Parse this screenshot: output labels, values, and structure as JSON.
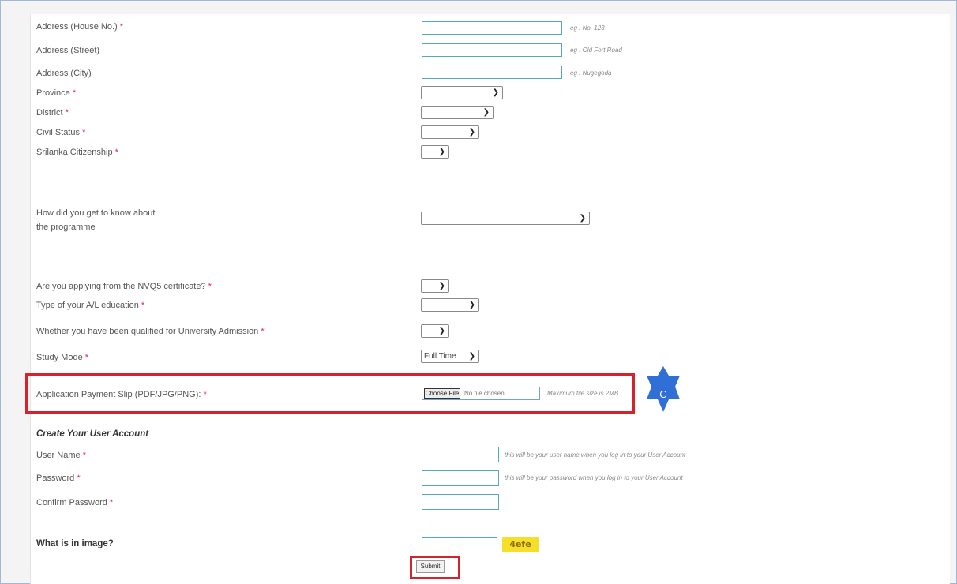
{
  "fields": {
    "house_no": {
      "label": "Address (House No.)",
      "hint": "eg : No. 123"
    },
    "street": {
      "label": "Address (Street)",
      "hint": "eg : Old Fort Road"
    },
    "city": {
      "label": "Address (City)",
      "hint": "eg : Nugegoda"
    },
    "province": {
      "label": "Province"
    },
    "district": {
      "label": "District"
    },
    "civil_status": {
      "label": "Civil Status"
    },
    "citizenship": {
      "label": "Srilanka Citizenship"
    },
    "how_know_line1": "How did you get to know about",
    "how_know_line2": "the programme",
    "nvq": {
      "label": "Are you applying from the NVQ5 certificate?"
    },
    "al_type": {
      "label": "Type of your A/L education"
    },
    "university": {
      "label": "Whether you have been qualified for University Admission"
    },
    "study_mode": {
      "label": "Study Mode",
      "value": "Full Time"
    },
    "payment_slip": {
      "label": "Application Payment Slip (PDF/JPG/PNG):",
      "choose_button": "Choose File",
      "no_file": "No file chosen",
      "hint": "Maximum file size is 2MB"
    }
  },
  "account": {
    "heading": "Create Your User Account",
    "username": {
      "label": "User Name",
      "hint": "this will be your user name when you log in to your User Account"
    },
    "password": {
      "label": "Password",
      "hint": "this will be your password when you log in to your User Account"
    },
    "confirm": {
      "label": "Confirm Password"
    }
  },
  "captcha": {
    "label": "What is in image?",
    "code": "4efe"
  },
  "submit_label": "Submit",
  "required_mark": "*",
  "badge_letter": "C",
  "colors": {
    "required": "#e2264a",
    "highlight": "#d6222d",
    "input_border": "#55a8b6",
    "badge": "#2f6fd6",
    "captcha_bg": "#f6df2a"
  }
}
